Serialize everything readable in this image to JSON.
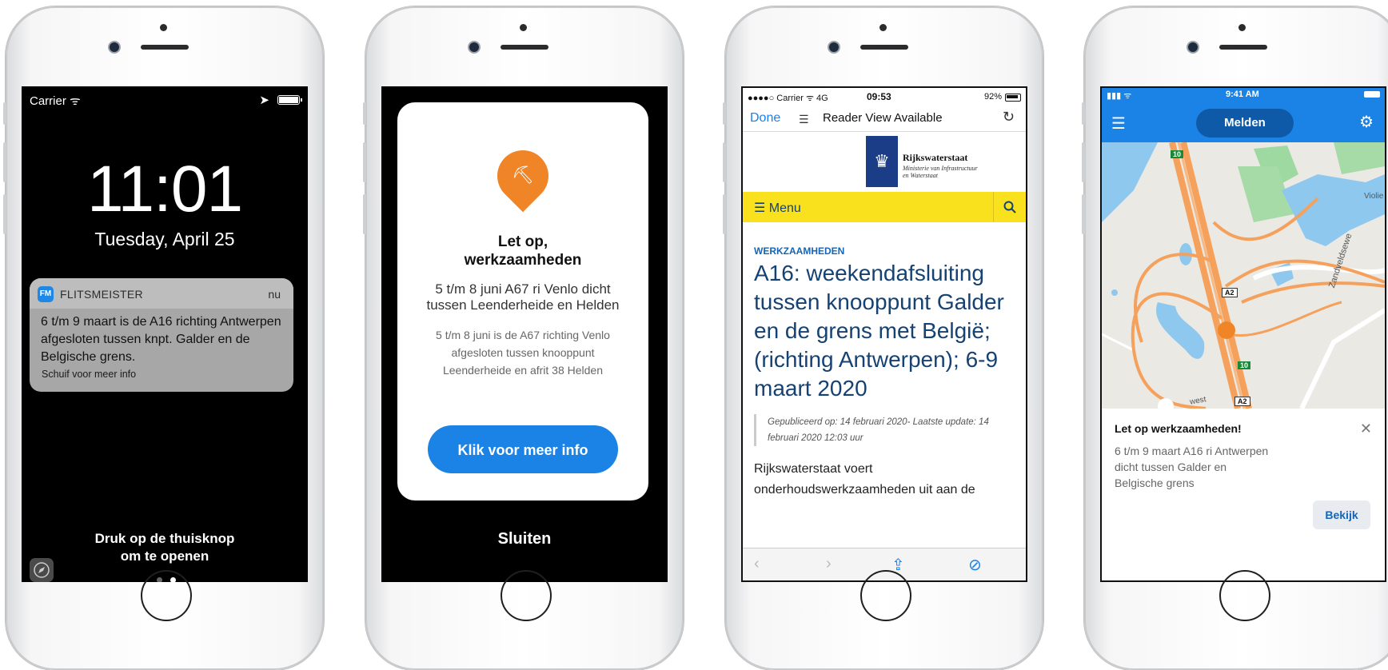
{
  "lockscreen": {
    "carrier": "Carrier",
    "time": "11:01",
    "date": "Tuesday, April 25",
    "notification": {
      "app_icon_text": "FM",
      "app_name": "FLITSMEISTER",
      "time": "nu",
      "message": "6 t/m 9 maart is de A16 richting Antwerpen afgesloten tussen knpt. Galder en de Belgische grens.",
      "hint": "Schuif voor meer info"
    },
    "unlock_hint_line1": "Druk op de thuisknop",
    "unlock_hint_line2": "om te openen"
  },
  "popup": {
    "title_line1": "Let op,",
    "title_line2": "werkzaamheden",
    "subtitle": "5 t/m 8 juni A67 ri Venlo dicht tussen Leenderheide en Helden",
    "body": "5 t/m 8 juni is de A67 richting Venlo afgesloten tussen knooppunt Leenderheide en afrit 38 Helden",
    "button_label": "Klik voor meer info",
    "close_label": "Sluiten"
  },
  "browser": {
    "status_left": "●●●●○ Carrier ᯤ 4G",
    "status_time": "09:53",
    "status_right": "92%",
    "done_label": "Done",
    "reader_label": "Reader View Available",
    "logo_name": "Rijkswaterstaat",
    "logo_sub": "Ministerie van Infrastructuur en Waterstaat",
    "menu_label": "Menu",
    "kicker": "WERKZAAMHEDEN",
    "headline": "A16: weekendafsluiting tussen knooppunt Galder en de grens met België; (richting Antwerpen); 6-9 maart 2020",
    "published": "Gepubliceerd op: 14 februari 2020- Laatste update: 14 februari 2020 12:03 uur",
    "body": "Rijkswaterstaat voert onderhoudswerkzaamheden uit aan de"
  },
  "appmap": {
    "status_time": "9:41 AM",
    "melden_label": "Melden",
    "map_labels": {
      "road_a2_1": "A2",
      "road_a2_2": "A2",
      "road_10_1": "10",
      "road_10_2": "10",
      "street_1": "Zandveldsewe",
      "street_2": "Violie",
      "street_3": "west"
    },
    "alert": {
      "title": "Let op werkzaamheden!",
      "body": "6 t/m 9 maart A16 ri Antwerpen dicht tussen Galder en Belgische grens",
      "button_label": "Bekijk"
    }
  }
}
